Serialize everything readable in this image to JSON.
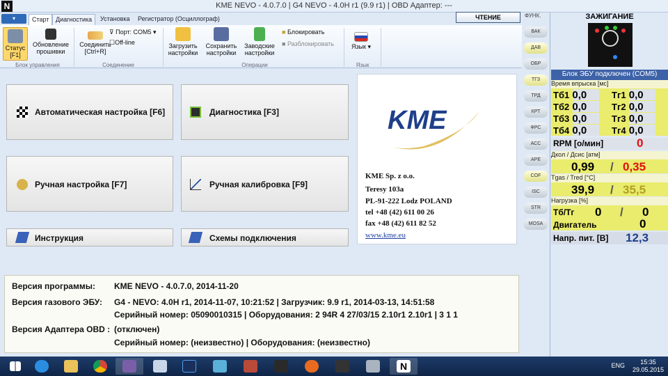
{
  "window": {
    "title": "KME NEVO - 4.0.7.0  |  G4 NEVO - 4.0H r1 (9.9 r1)  |  OBD Адаптер: ---",
    "app_glyph": "N"
  },
  "ribbon": {
    "app_menu": "▾",
    "tabs": [
      "Старт",
      "Диагностика",
      "Установка",
      "Регистратор (Осциллограф)"
    ],
    "readout_button": "ЧТЕНИЕ",
    "buttons": {
      "status": "Статус [F1]",
      "update_fw": "Обновление прошивки",
      "connect": "Соединить [Ctrl+R]",
      "port": "Порт: COM5",
      "offline": "Off-line",
      "load": "Загрузить настройки",
      "save": "Сохранить настройки",
      "factory": "Заводские настройки",
      "lock": "Блокировать",
      "unlock": "Разблокировать",
      "language": "Язык"
    },
    "groups": [
      "Блок управления",
      "Соединение",
      "Операции",
      "Язык"
    ]
  },
  "side_strip": {
    "label": "ФУНК.",
    "items": [
      "ВАК",
      "ДАВ",
      "ОБР",
      "ТГЗ",
      "ТРД",
      "КРТ",
      "ФРС",
      "АСС",
      "АРЕ",
      "COF",
      "ISC",
      "STR",
      "MOSA"
    ]
  },
  "main": {
    "buttons": [
      "Автоматическая настройка [F6]",
      "Диагностика [F3]",
      "Ручная настройка [F7]",
      "Ручная калибровка [F9]",
      "Инструкция",
      "Схемы подключения"
    ],
    "company": {
      "logo": "KME",
      "name": "KME Sp. z o.o.",
      "street": "Teresy 103a",
      "city": "PL-91-222 Lodz  POLAND",
      "tel": "tel +48 (42) 611 00 26",
      "fax": "fax +48 (42) 611 82 52",
      "web": "www.kme.eu"
    }
  },
  "info": {
    "program_label": "Версия программы:",
    "program_value": "KME NEVO - 4.0.7.0, 2014-11-20",
    "ecu_label": "Версия газового ЭБУ:",
    "ecu_value": "G4 - NEVO: 4.0H r1, 2014-11-07, 10:21:52  |  Загрузчик: 9.9 r1, 2014-03-13, 14:51:58",
    "ecu_serial": "Серийный номер: 05090010315  |  Оборудования: 2 94R 4 27/03/15   2.10r1  2.10r1   |   3 1 1",
    "obd_label": "Версия Адаптера OBD :",
    "obd_value": "(отключен)",
    "obd_serial": "Серийный номер: (неизвестно)  |  Оборудования: (неизвестно)"
  },
  "panel": {
    "ignition": "ЗАЖИГАНИЕ",
    "ecu_status": "Блок ЭБУ подключен (COM5)",
    "inj_title": "Время впрыска [мс]",
    "inj": [
      {
        "l": "Тб1",
        "v": "0,0"
      },
      {
        "l": "Тг1",
        "v": "0,0"
      },
      {
        "l": "Тб2",
        "v": "0,0"
      },
      {
        "l": "Тг2",
        "v": "0,0"
      },
      {
        "l": "Тб3",
        "v": "0,0"
      },
      {
        "l": "Тг3",
        "v": "0,0"
      },
      {
        "l": "Тб4",
        "v": "0,0"
      },
      {
        "l": "Тг4",
        "v": "0,0"
      }
    ],
    "rpm_label": "RPM [о/мин]",
    "rpm": "0",
    "press_label": "Дкол / Дсис [атм]",
    "press_a": "0,99",
    "press_b": "0,35",
    "temp_label": "Tgas / Tred [°C]",
    "temp_a": "39,9",
    "temp_b": "35,5",
    "load_label": "Нагрузка [%]",
    "load_tb": "Тб/Тг",
    "load_a": "0",
    "load_b": "0",
    "engine_label": "Двигатель",
    "engine": "0",
    "volt_label": "Напр. пит. [В]",
    "volt": "12,3",
    "slash": "/"
  },
  "taskbar": {
    "lang": "ENG",
    "time": "15:35",
    "date": "29.05.2015"
  },
  "colors": {
    "red": "#e01010",
    "olive": "#b0a020",
    "blue": "#1e3f8a",
    "yellow": "#e9ec6c"
  }
}
